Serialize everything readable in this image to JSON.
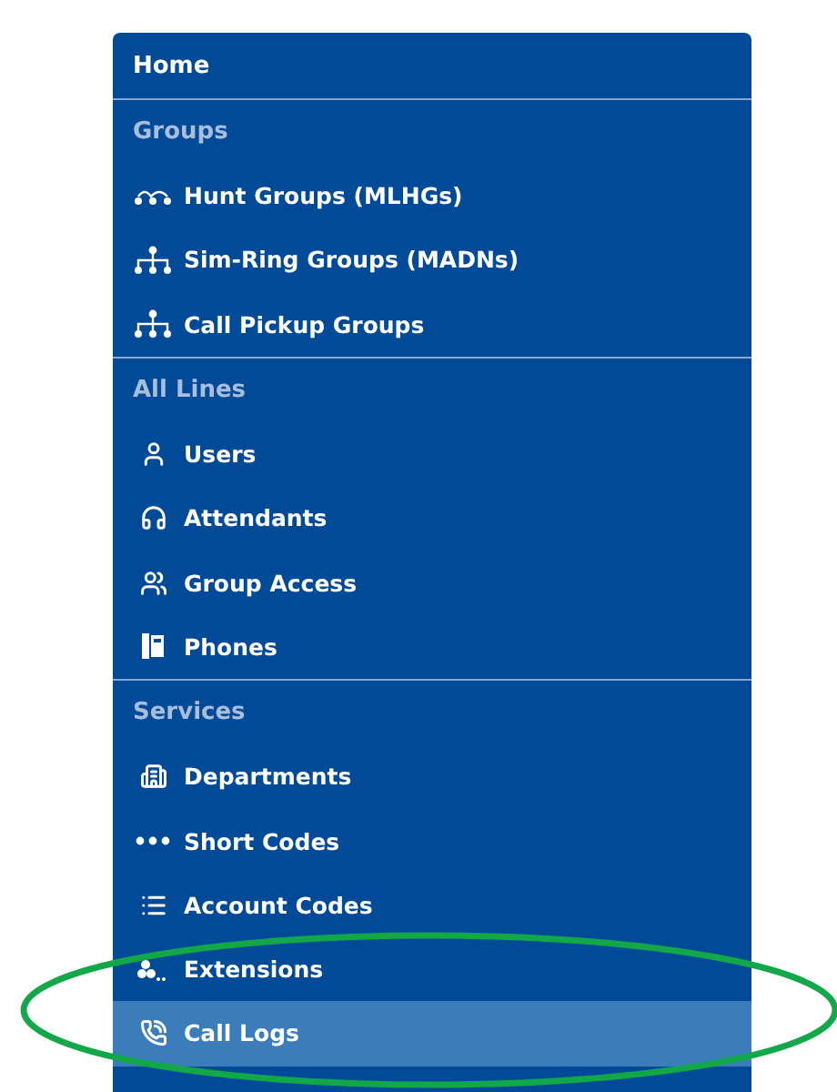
{
  "home": {
    "label": "Home"
  },
  "sections": [
    {
      "label": "Groups",
      "items": [
        {
          "label": "Hunt Groups (MLHGs)",
          "selected": false
        },
        {
          "label": "Sim-Ring Groups (MADNs)",
          "selected": false
        },
        {
          "label": "Call Pickup Groups",
          "selected": false
        }
      ]
    },
    {
      "label": "All Lines",
      "items": [
        {
          "label": "Users",
          "selected": false
        },
        {
          "label": "Attendants",
          "selected": false
        },
        {
          "label": "Group Access",
          "selected": false
        },
        {
          "label": "Phones",
          "selected": false
        }
      ]
    },
    {
      "label": "Services",
      "items": [
        {
          "label": "Departments",
          "selected": false
        },
        {
          "label": "Short Codes",
          "selected": false
        },
        {
          "label": "Account Codes",
          "selected": false
        },
        {
          "label": "Extensions",
          "selected": false
        },
        {
          "label": "Call Logs",
          "selected": true
        }
      ]
    }
  ]
}
